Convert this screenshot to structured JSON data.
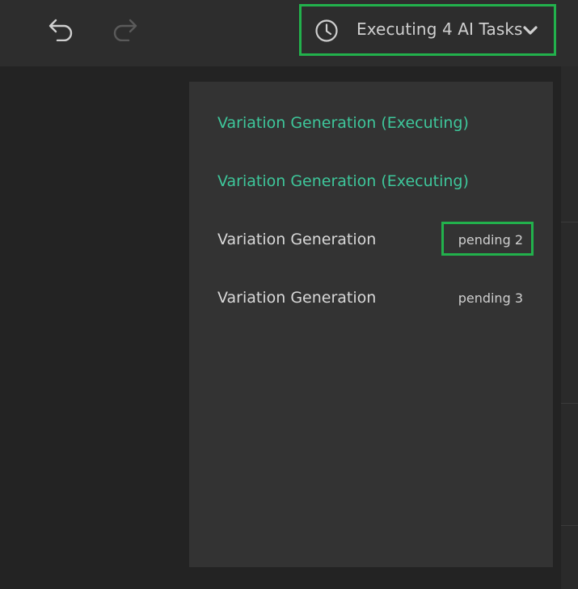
{
  "toolbar": {
    "undo_icon": "undo-icon",
    "redo_icon": "redo-icon"
  },
  "tasks_button": {
    "icon": "clock-icon",
    "label": "Executing 4 AI Tasks",
    "chevron": "chevron-down-icon"
  },
  "tasks_panel": {
    "items": [
      {
        "name": "Variation Generation (Executing)",
        "status": ""
      },
      {
        "name": "Variation Generation (Executing)",
        "status": ""
      },
      {
        "name": "Variation Generation",
        "status": "pending 2"
      },
      {
        "name": "Variation Generation",
        "status": "pending 3"
      }
    ]
  },
  "colors": {
    "executing": "#3ec79b",
    "highlight": "#22b14c"
  }
}
